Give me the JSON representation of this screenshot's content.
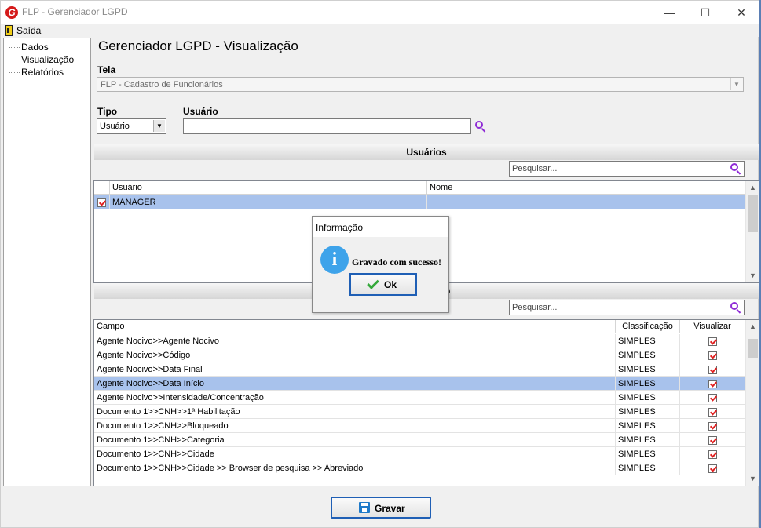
{
  "window": {
    "title": "FLP - Gerenciador LGPD",
    "minimize": "—",
    "maximize": "☐",
    "close": "✕"
  },
  "menu": {
    "exit_label": "Saída"
  },
  "tree": {
    "items": [
      {
        "label": "Dados"
      },
      {
        "label": "Visualização"
      },
      {
        "label": "Relatórios"
      }
    ]
  },
  "main": {
    "title": "Gerenciador LGPD - Visualização",
    "tela_label": "Tela",
    "tela_value": "FLP - Cadastro de Funcionários",
    "tipo_label": "Tipo",
    "tipo_value": "Usuário",
    "usuario_label": "Usuário",
    "usuario_value": ""
  },
  "users_section": {
    "title": "Usuários",
    "search_placeholder": "Pesquisar...",
    "columns": [
      "Usuário",
      "Nome"
    ],
    "rows": [
      {
        "checked": true,
        "usuario": "MANAGER",
        "nome": ""
      }
    ]
  },
  "fields_section": {
    "title": "o",
    "search_placeholder": "Pesquisar...",
    "columns": [
      "Campo",
      "Classificação",
      "Visualizar"
    ],
    "rows": [
      {
        "campo": "Agente Nocivo>>Agente Nocivo",
        "classificacao": "SIMPLES",
        "visualizar": true
      },
      {
        "campo": "Agente Nocivo>>Código",
        "classificacao": "SIMPLES",
        "visualizar": true
      },
      {
        "campo": "Agente Nocivo>>Data Final",
        "classificacao": "SIMPLES",
        "visualizar": true
      },
      {
        "campo": "Agente Nocivo>>Data Início",
        "classificacao": "SIMPLES",
        "visualizar": true,
        "selected": true
      },
      {
        "campo": "Agente Nocivo>>Intensidade/Concentração",
        "classificacao": "SIMPLES",
        "visualizar": true
      },
      {
        "campo": "Documento 1>>CNH>>1ª Habilitação",
        "classificacao": "SIMPLES",
        "visualizar": true
      },
      {
        "campo": "Documento 1>>CNH>>Bloqueado",
        "classificacao": "SIMPLES",
        "visualizar": true
      },
      {
        "campo": "Documento 1>>CNH>>Categoria",
        "classificacao": "SIMPLES",
        "visualizar": true
      },
      {
        "campo": "Documento 1>>CNH>>Cidade",
        "classificacao": "SIMPLES",
        "visualizar": true
      },
      {
        "campo": "Documento 1>>CNH>>Cidade >> Browser de pesquisa >> Abreviado",
        "classificacao": "SIMPLES",
        "visualizar": true
      }
    ]
  },
  "footer": {
    "save_label": "Gravar"
  },
  "dialog": {
    "title": "Informação",
    "message": "Gravado com sucesso!",
    "ok_label": "Ok"
  }
}
